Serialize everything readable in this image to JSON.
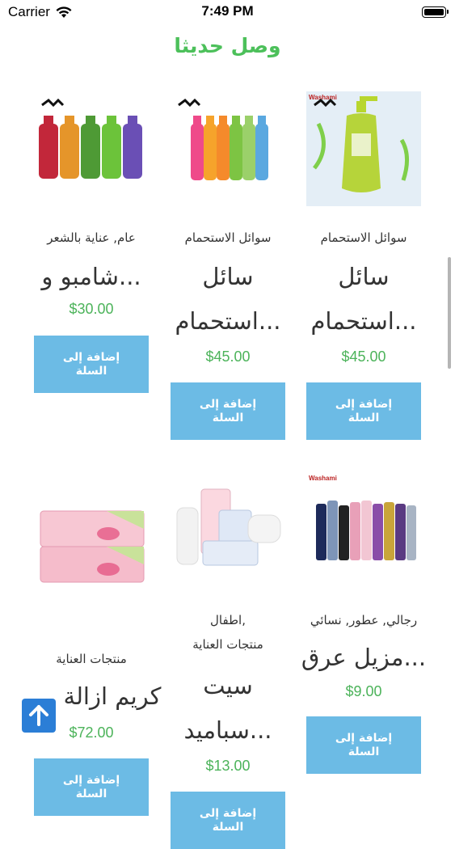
{
  "status": {
    "carrier": "Carrier",
    "time": "7:49 PM"
  },
  "section_title": "وصل حديثا",
  "colors": {
    "accent_green": "#4cc05a",
    "button_blue": "#6cbbe5",
    "scroll_top_blue": "#2b7ed6"
  },
  "brand_logo_text": "Washami",
  "products": [
    {
      "category": "سوائل الاستحمام",
      "name_line1": "سائل",
      "name_line2": "استحمام...",
      "price": "$45.00",
      "button": "إضافة إلى السلة",
      "icon": "shower-gel-bottle-icon"
    },
    {
      "category": "سوائل الاستحمام",
      "name_line1": "سائل",
      "name_line2": "استحمام...",
      "price": "$45.00",
      "button": "إضافة إلى السلة",
      "icon": "shower-gel-bottles-icon"
    },
    {
      "category": "عام, عناية بالشعر",
      "name_line1": "شامبو و...",
      "price": "$30.00",
      "button": "إضافة إلى السلة",
      "icon": "shampoo-bottles-icon"
    },
    {
      "category": "رجالي, عطور, نسائي",
      "name_line1": "مزيل عرق...",
      "price": "$9.00",
      "button": "إضافة إلى السلة",
      "icon": "deodorant-sprays-icon"
    },
    {
      "category_line1": "اطفال,",
      "category_line2": "منتجات العناية",
      "name_line1": "سيت",
      "name_line2": "سباميد...",
      "price": "$13.00",
      "button": "إضافة إلى السلة",
      "icon": "baby-care-set-icon"
    },
    {
      "category": "منتجات العناية",
      "name_line1": "كريم ازالة",
      "price": "$72.00",
      "button": "إضافة إلى السلة",
      "icon": "hair-removal-cream-icon"
    }
  ],
  "scroll_to_top_icon": "arrow-up-icon"
}
